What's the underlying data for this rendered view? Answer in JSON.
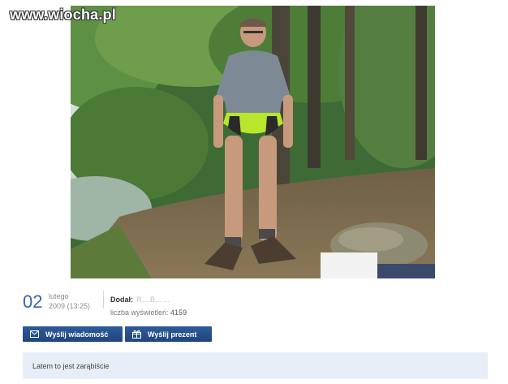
{
  "watermark": "www.wiocha.pl",
  "post": {
    "day": "02",
    "month": "lutego",
    "year_time": "2009 (13:25)",
    "added_label": "Dodał:",
    "added_user": "R... B... ...",
    "views_label": "liczba wyświetleń:",
    "views_count": "4159"
  },
  "actions": {
    "send_message": "Wyślij wiadomość",
    "send_gift": "Wyślij prezent"
  },
  "description": "Latem to jest zarąbiście",
  "colors": {
    "accent": "#3a63a8",
    "button": "#2a5594",
    "desc_background": "#e8eef8"
  },
  "icons": [
    "envelope-icon",
    "gift-icon"
  ]
}
